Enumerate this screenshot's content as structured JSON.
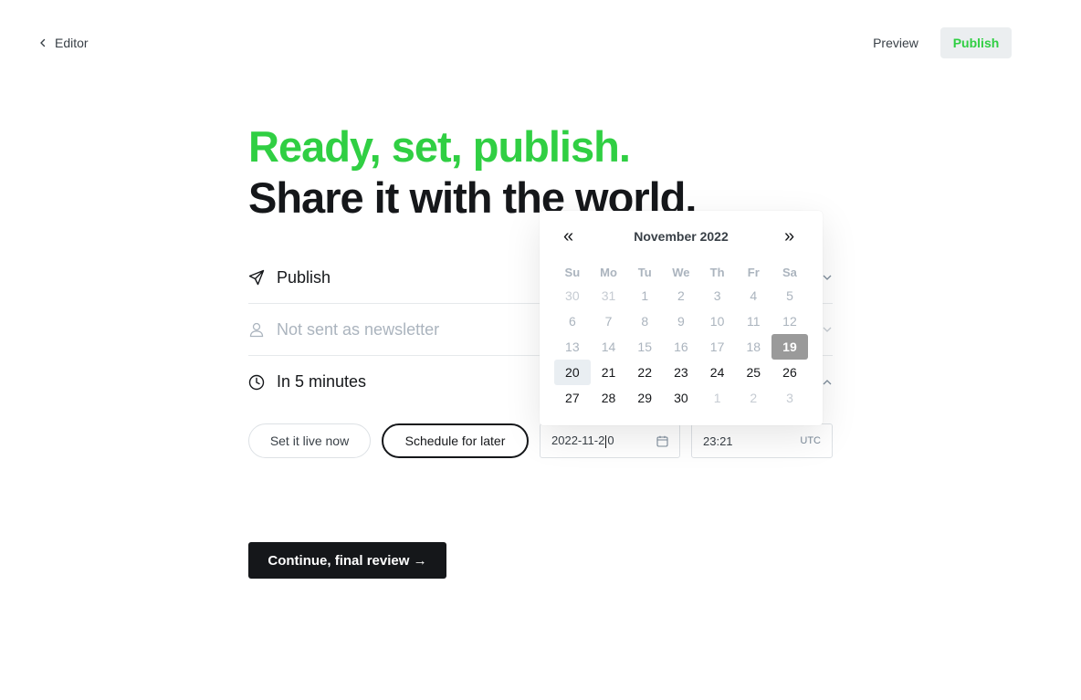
{
  "topbar": {
    "back_label": "Editor",
    "preview_label": "Preview",
    "publish_label": "Publish"
  },
  "headline": {
    "line1": "Ready, set, publish.",
    "line2": "Share it with the world."
  },
  "settings": {
    "publish_row": "Publish",
    "newsletter_row": "Not sent as newsletter",
    "schedule_row": "In 5 minutes"
  },
  "schedule": {
    "live_now_label": "Set it live now",
    "later_label": "Schedule for later",
    "date_value_before": "2022-11-2",
    "date_value_after": "0",
    "time_value": "23:21",
    "timezone": "UTC"
  },
  "calendar": {
    "prev": "«",
    "next": "»",
    "month_title": "November 2022",
    "weekdays": [
      "Su",
      "Mo",
      "Tu",
      "We",
      "Th",
      "Fr",
      "Sa"
    ],
    "weeks": [
      [
        "30",
        "31",
        "1",
        "2",
        "3",
        "4",
        "5"
      ],
      [
        "6",
        "7",
        "8",
        "9",
        "10",
        "11",
        "12"
      ],
      [
        "13",
        "14",
        "15",
        "16",
        "17",
        "18",
        "19"
      ],
      [
        "20",
        "21",
        "22",
        "23",
        "24",
        "25",
        "26"
      ],
      [
        "27",
        "28",
        "29",
        "30",
        "1",
        "2",
        "3"
      ]
    ]
  },
  "continue_label": "Continue, final review →",
  "colors": {
    "brand_green": "#30cf43",
    "text_dark": "#15171a"
  }
}
